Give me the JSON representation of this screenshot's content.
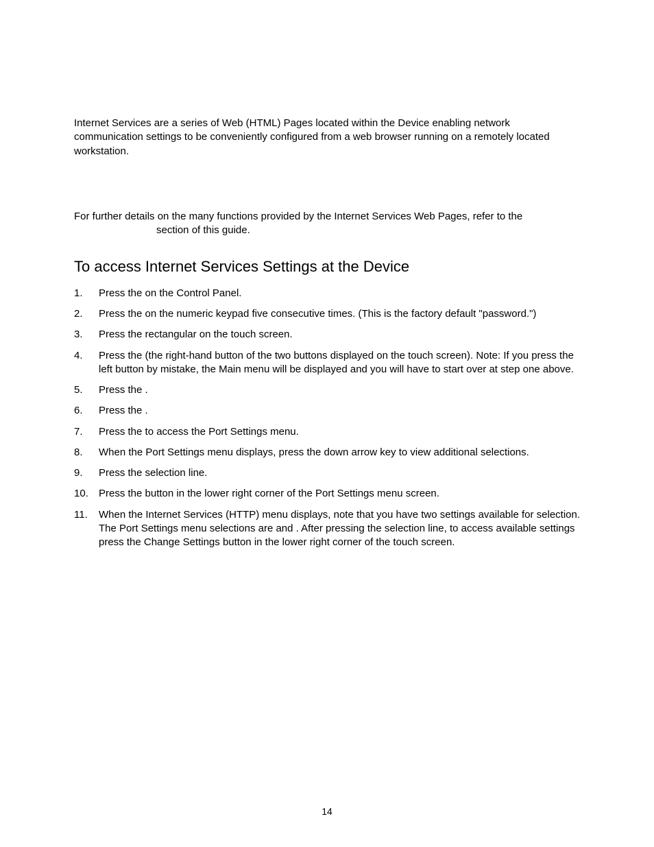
{
  "intro": "Internet Services are a series of Web (HTML) Pages located within the Device enabling network communication settings to be conveniently configured from a web browser running on a remotely located workstation.",
  "refNote": {
    "line1": "For further details on the many functions provided by the Internet Services Web Pages, refer to the",
    "line2": "section of this guide."
  },
  "heading": "To access Internet Services Settings at the Device",
  "steps": [
    "Press the                                  on the Control Panel.",
    "Press the                 on the numeric keypad five consecutive times.  (This is the factory default \"password.\")",
    "Press the rectangular                            on the touch screen.",
    "Press the                                              (the right-hand button of the two buttons displayed on the touch screen).  Note:  If you press the left button by mistake, the Main menu will be displayed and you will have to start over at step one above.",
    "Press the                                             .",
    "Press the                                             .",
    "Press the                                     to access the Port Settings menu.",
    "When the Port Settings menu displays, press the down arrow key to view additional selections.",
    "Press the                                               selection line.",
    "Press the                               button in the lower right corner of the Port Settings menu screen.",
    "When the Internet Services (HTTP) menu displays, note that you have two settings available for selection.  The Port Settings menu selections are                           and                                              .  After pressing the selection line, to access available settings press the Change Settings button in the lower right corner of the touch screen."
  ],
  "pageNumber": "14"
}
